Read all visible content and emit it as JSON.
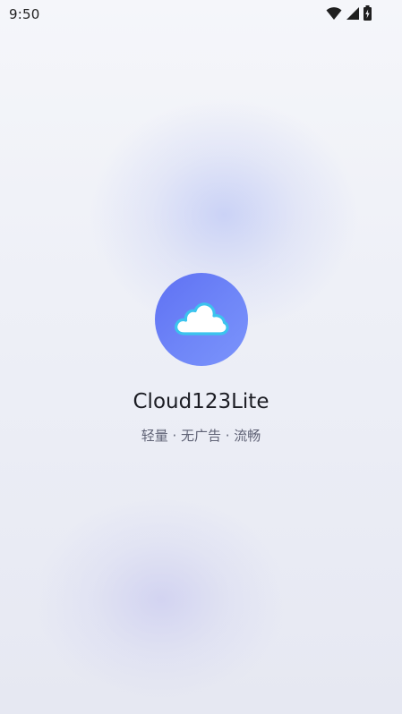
{
  "status_bar": {
    "time": "9:50",
    "icons": [
      "wifi-icon",
      "cellular-signal-icon",
      "battery-charging-icon"
    ]
  },
  "splash": {
    "logo_icon": "cloud-icon",
    "app_name": "Cloud123Lite",
    "tagline": "轻量 · 无广告 · 流畅"
  },
  "colors": {
    "logo_gradient_start": "#5f71f3",
    "logo_gradient_end": "#7b94fb",
    "cloud_fill": "#ffffff",
    "cloud_outline": "#3cc3ee",
    "title_text": "#1c1d24",
    "tagline_text": "#5f6275"
  }
}
